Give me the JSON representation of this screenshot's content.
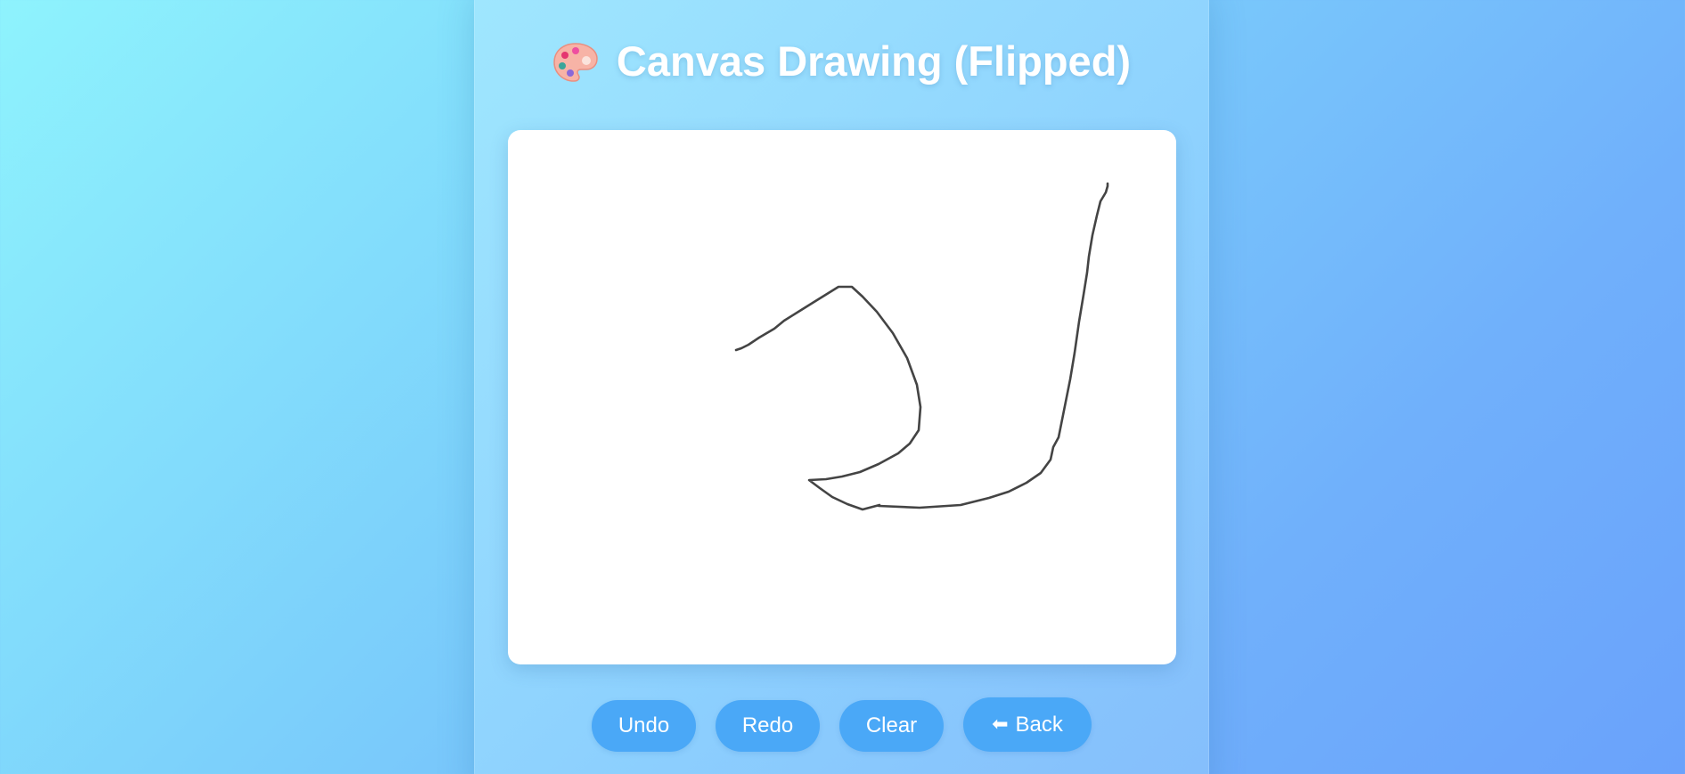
{
  "header": {
    "title": "Canvas Drawing (Flipped)",
    "icon": "palette-icon"
  },
  "canvas": {
    "background": "#ffffff",
    "stroke_color": "#444444"
  },
  "toolbar": {
    "undo_label": "Undo",
    "redo_label": "Redo",
    "clear_label": "Clear",
    "back_label": "Back",
    "back_icon": "left-arrow-icon",
    "accent": "#4aa8f7"
  }
}
